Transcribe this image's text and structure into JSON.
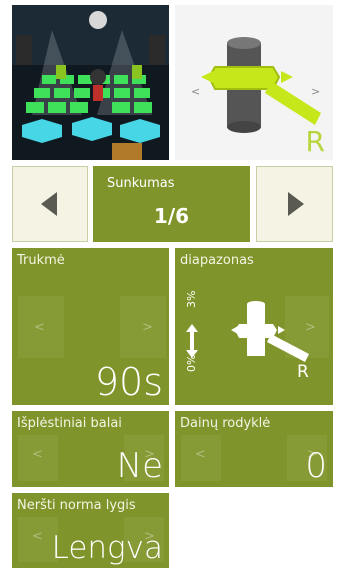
{
  "difficulty": {
    "label": "Sunkumas",
    "value": "1/6"
  },
  "duration": {
    "label": "Trukmė",
    "value": "90s",
    "prev": "<",
    "next": ">"
  },
  "range": {
    "label": "diapazonas",
    "upper": "3%",
    "lower": "0%",
    "mode": "R",
    "prev": "<",
    "next": ">"
  },
  "extended_scores": {
    "label": "Išplėstiniai balai",
    "value": "Ne",
    "prev": "<",
    "next": ">"
  },
  "song_indicator": {
    "label": "Dainų rodyklė",
    "value": "0",
    "prev": "<",
    "next": ">"
  },
  "wear_norm": {
    "label": "Neršti norma lygis",
    "value": "Lengva",
    "prev": "<",
    "next": ">"
  },
  "hold_icon_letter": "R",
  "colors": {
    "tile_green": "#7f942a",
    "nav_bg": "#f5f3e4",
    "accent_lime": "#c6e81a"
  }
}
